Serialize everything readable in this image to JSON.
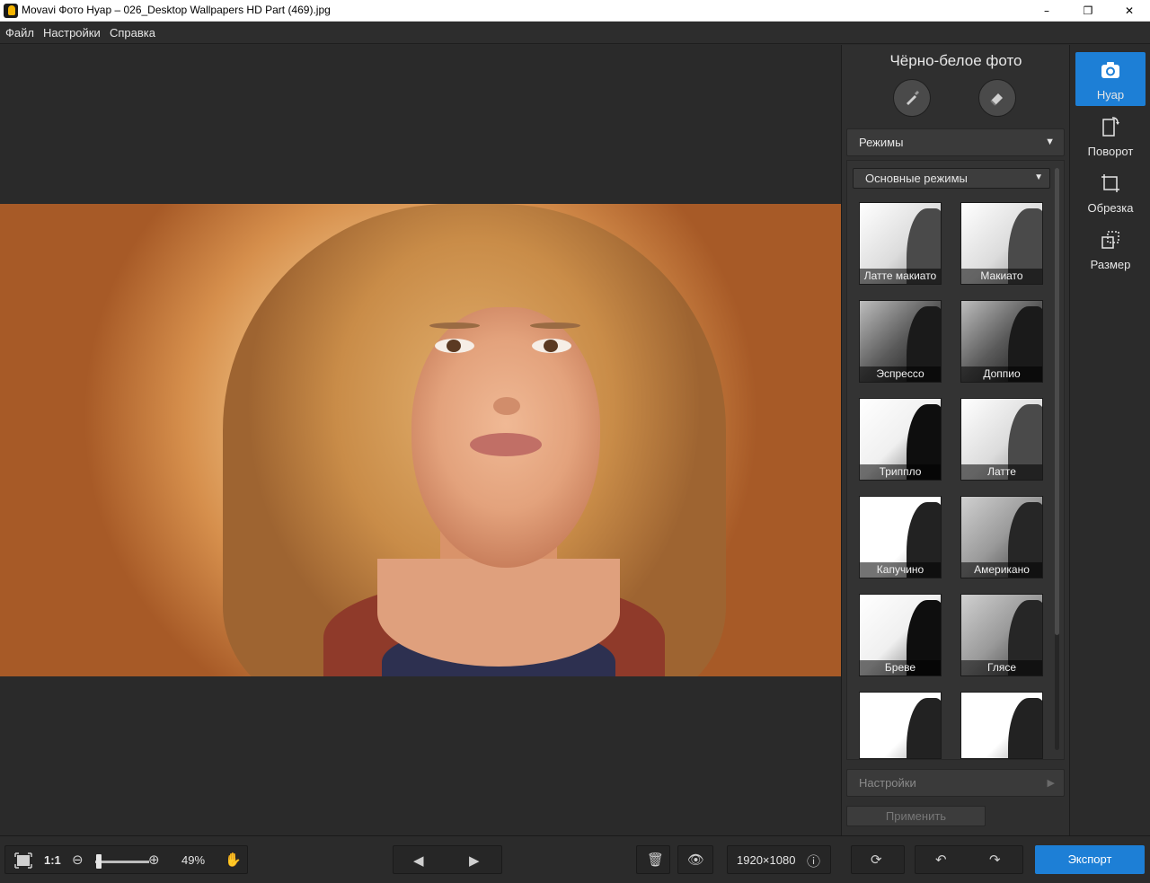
{
  "window": {
    "title": "Movavi Фото Нуар – 026_Desktop Wallpapers  HD Part (469).jpg"
  },
  "menu": [
    "Файл",
    "Настройки",
    "Справка"
  ],
  "panel": {
    "title": "Чёрно-белое фото",
    "modes_header": "Режимы",
    "modes_dropdown": "Основные режимы",
    "thumbnails": [
      {
        "label": "Латте макиато",
        "tone": "light"
      },
      {
        "label": "Макиато",
        "tone": "light"
      },
      {
        "label": "Эспрессо",
        "tone": "dark"
      },
      {
        "label": "Доппио",
        "tone": "dark"
      },
      {
        "label": "Триппло",
        "tone": "contrast"
      },
      {
        "label": "Латте",
        "tone": "light"
      },
      {
        "label": "Капучино",
        "tone": "white"
      },
      {
        "label": "Американо",
        "tone": "mid"
      },
      {
        "label": "Бреве",
        "tone": "contrast"
      },
      {
        "label": "Глясе",
        "tone": "mid"
      },
      {
        "label": "",
        "tone": "white"
      },
      {
        "label": "",
        "tone": "white"
      }
    ],
    "settings_header": "Настройки",
    "apply_label": "Применить"
  },
  "tools": [
    {
      "label": "Нуар",
      "icon": "camera-icon",
      "active": true
    },
    {
      "label": "Поворот",
      "icon": "rotate-icon",
      "active": false
    },
    {
      "label": "Обрезка",
      "icon": "crop-icon",
      "active": false
    },
    {
      "label": "Размер",
      "icon": "resize-icon",
      "active": false
    }
  ],
  "bottom": {
    "one_to_one": "1:1",
    "zoom_level": "49%",
    "zoom_fraction": 0.05,
    "dimensions": "1920×1080",
    "export_label": "Экспорт"
  },
  "colors": {
    "accent": "#1d7fd6",
    "panel_bg": "#2f2f2f",
    "canvas_bg": "#2a2a2a"
  }
}
